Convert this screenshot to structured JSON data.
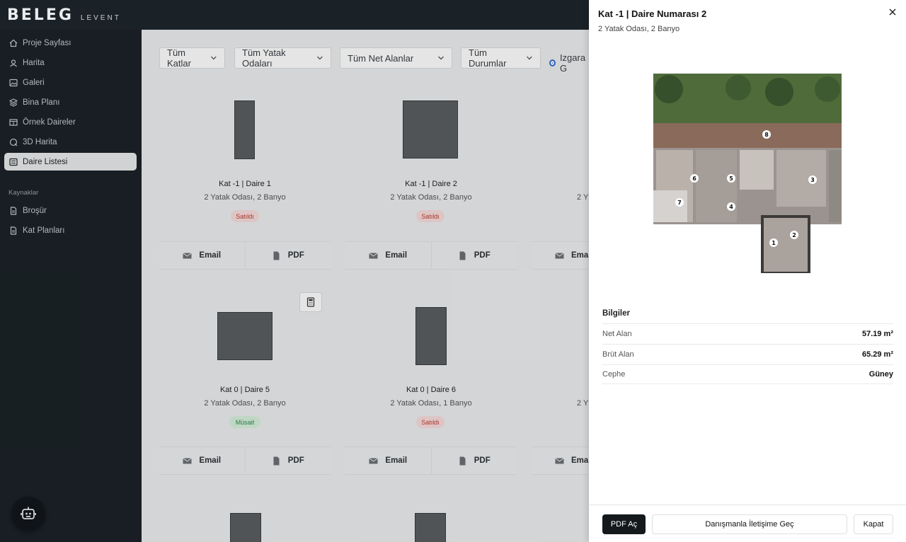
{
  "brand": {
    "name": "BELEG",
    "sub": "LEVENT"
  },
  "sidebar": {
    "items": [
      {
        "label": "Proje Sayfası",
        "icon": "home-icon"
      },
      {
        "label": "Harita",
        "icon": "map-pin-icon"
      },
      {
        "label": "Galeri",
        "icon": "image-icon"
      },
      {
        "label": "Bina Planı",
        "icon": "layers-icon"
      },
      {
        "label": "Örnek Daireler",
        "icon": "window-icon"
      },
      {
        "label": "3D Harita",
        "icon": "cube-icon"
      },
      {
        "label": "Daire Listesi",
        "icon": "list-icon"
      }
    ],
    "resources_label": "Kaynaklar",
    "resources": [
      {
        "label": "Broşür",
        "icon": "document-icon"
      },
      {
        "label": "Kat Planları",
        "icon": "document-icon"
      }
    ]
  },
  "filters": {
    "floors": "Tüm Katlar",
    "bedrooms": "Tüm Yatak Odaları",
    "net_areas": "Tüm Net Alanlar",
    "statuses": "Tüm Durumlar",
    "view_option": "Izgara G"
  },
  "cards": [
    {
      "title": "Kat -1 | Daire 1",
      "sub": "2 Yatak Odası, 2 Banyo",
      "status": "Satıldı"
    },
    {
      "title": "Kat -1 | Daire 2",
      "sub": "2 Yatak Odası, 2 Banyo",
      "status": "Satıldı"
    },
    {
      "title": "",
      "sub": "2 Y",
      "status": ""
    },
    {
      "title": "Kat 0 | Daire 5",
      "sub": "2 Yatak Odası, 2 Banyo",
      "status": "Müsait"
    },
    {
      "title": "Kat 0 | Daire 6",
      "sub": "2 Yatak Odası, 1 Banyo",
      "status": "Satıldı"
    },
    {
      "title": "",
      "sub": "2 Y",
      "status": ""
    }
  ],
  "card_actions": {
    "email": "Email",
    "pdf": "PDF",
    "email_cut": "Emai"
  },
  "drawer": {
    "title": "Kat -1 | Daire Numarası 2",
    "subtitle": "2 Yatak Odası, 2 Banyo",
    "info_heading": "Bilgiler",
    "rows": [
      {
        "key": "Net Alan",
        "value": "57.19 m²"
      },
      {
        "key": "Brüt Alan",
        "value": "65.29 m²"
      },
      {
        "key": "Cephe",
        "value": "Güney"
      }
    ],
    "plan_labels": [
      "8",
      "6",
      "5",
      "3",
      "7",
      "4",
      "2",
      "1"
    ],
    "buttons": {
      "pdf": "PDF Aç",
      "contact": "Danışmanla İletişime Geç",
      "close": "Kapat"
    }
  }
}
